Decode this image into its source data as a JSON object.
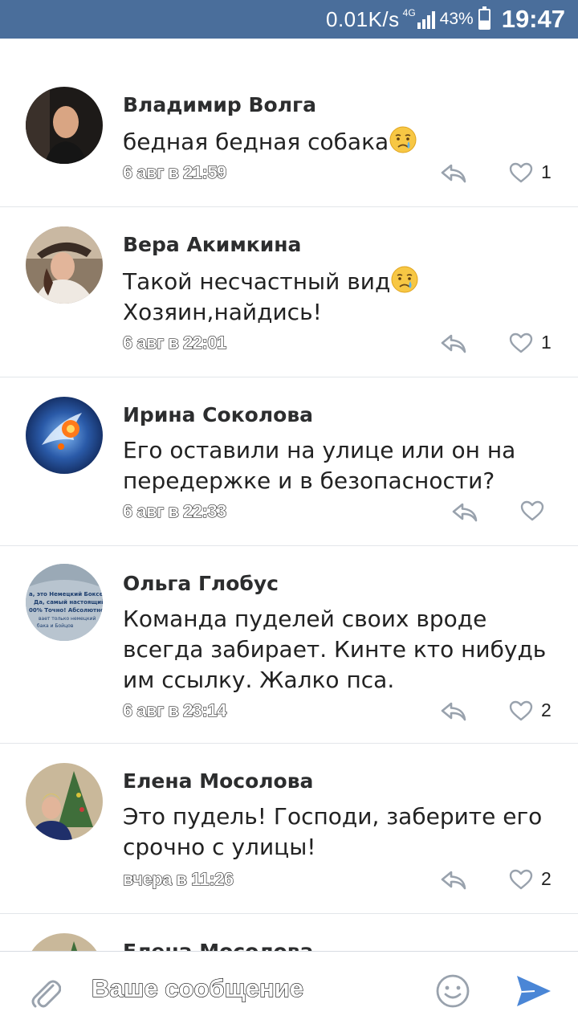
{
  "status_bar": {
    "net_speed": "0.01K/s",
    "network_type": "4G",
    "battery": "43%",
    "time": "19:47"
  },
  "comments": [
    {
      "author": "Владимир Волга",
      "text": "бедная бедная собака",
      "emoji": "crying-face",
      "date": "6 авг в 21:59",
      "likes": "1"
    },
    {
      "author": "Вера Акимкина",
      "text_line1": "Такой несчастный вид",
      "emoji": "crying-face",
      "text_line2": "Хозяин,найдись!",
      "date": "6 авг в 22:01",
      "likes": "1"
    },
    {
      "author": "Ирина Соколова",
      "text": "Его оставили на улице или он на передержке и в безопасности?",
      "date": "6 авг в 22:33",
      "likes": ""
    },
    {
      "author": "Ольга Глобус",
      "text": "Команда пуделей своих вроде всегда забирает. Кинте кто нибудь им ссылку. Жалко пса.",
      "date": "6 авг в 23:14",
      "likes": "2",
      "avatar_lines": [
        "а, это Немецкий Боксер",
        "Да, самый настоящий!",
        "00% Точно! Абсолютно!",
        "вает только немецкий",
        "бака и Бойцов"
      ]
    },
    {
      "author": "Елена Мосолова",
      "text": "Это пудель! Господи, заберите его срочно с улицы!",
      "date": "вчера в 11:26",
      "likes": "2"
    },
    {
      "author": "Елена Мосолова"
    }
  ],
  "composer": {
    "placeholder": "Ваше сообщение"
  },
  "icons": {
    "attach": "paperclip-icon",
    "emoji": "smile-icon",
    "send": "send-icon",
    "reply": "reply-icon",
    "like": "heart-icon"
  },
  "colors": {
    "status_bar": "#4a6e9b",
    "send_accent": "#4a86d6",
    "icon_gray": "#99a2ad"
  }
}
